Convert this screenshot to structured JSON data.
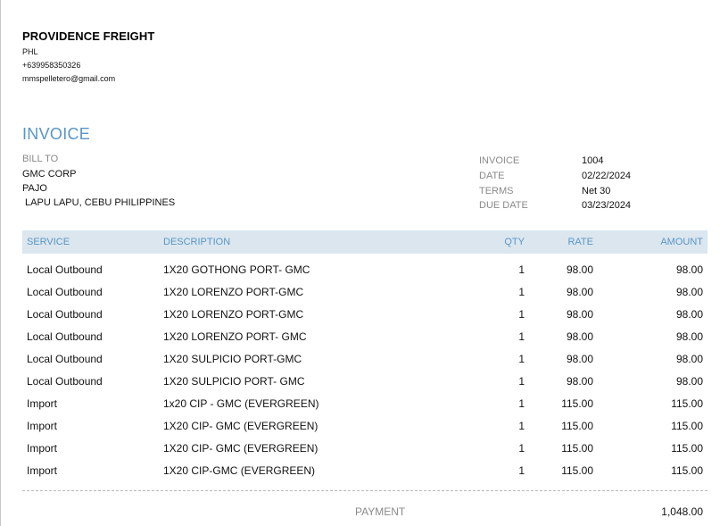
{
  "company": {
    "name": "PROVIDENCE FREIGHT",
    "country": "PHL",
    "phone": "+639958350326",
    "email": "mmspelletero@gmail.com"
  },
  "title": "INVOICE",
  "bill_to": {
    "label": "BILL TO",
    "line1": "GMC CORP",
    "line2": "PAJO",
    "line3": " LAPU LAPU, CEBU PHILIPPINES"
  },
  "meta": {
    "invoice_label": "INVOICE",
    "invoice_value": "1004",
    "date_label": "DATE",
    "date_value": "02/22/2024",
    "terms_label": "TERMS",
    "terms_value": "Net 30",
    "due_label": "DUE DATE",
    "due_value": "03/23/2024"
  },
  "table": {
    "headers": {
      "service": "SERVICE",
      "description": "DESCRIPTION",
      "qty": "QTY",
      "rate": "RATE",
      "amount": "AMOUNT"
    },
    "rows": [
      {
        "service": "Local Outbound",
        "description": "1X20 GOTHONG PORT- GMC",
        "qty": "1",
        "rate": "98.00",
        "amount": "98.00"
      },
      {
        "service": "Local Outbound",
        "description": "1X20 LORENZO PORT-GMC",
        "qty": "1",
        "rate": "98.00",
        "amount": "98.00"
      },
      {
        "service": "Local Outbound",
        "description": "1X20 LORENZO PORT-GMC",
        "qty": "1",
        "rate": "98.00",
        "amount": "98.00"
      },
      {
        "service": "Local Outbound",
        "description": "1X20 LORENZO PORT- GMC",
        "qty": "1",
        "rate": "98.00",
        "amount": "98.00"
      },
      {
        "service": "Local Outbound",
        "description": "1X20 SULPICIO PORT-GMC",
        "qty": "1",
        "rate": "98.00",
        "amount": "98.00"
      },
      {
        "service": "Local Outbound",
        "description": "1X20 SULPICIO PORT- GMC",
        "qty": "1",
        "rate": "98.00",
        "amount": "98.00"
      },
      {
        "service": "Import",
        "description": "1x20 CIP - GMC (EVERGREEN)",
        "qty": "1",
        "rate": "115.00",
        "amount": "115.00"
      },
      {
        "service": "Import",
        "description": "1X20 CIP- GMC (EVERGREEN)",
        "qty": "1",
        "rate": "115.00",
        "amount": "115.00"
      },
      {
        "service": "Import",
        "description": "1X20 CIP- GMC (EVERGREEN)",
        "qty": "1",
        "rate": "115.00",
        "amount": "115.00"
      },
      {
        "service": "Import",
        "description": "1X20 CIP-GMC (EVERGREEN)",
        "qty": "1",
        "rate": "115.00",
        "amount": "115.00"
      }
    ]
  },
  "payment": {
    "label": "PAYMENT",
    "value": "1,048.00"
  },
  "colors": {
    "accent": "#5a96c4",
    "header_bg": "#dbe6ef",
    "label_gray": "#8a8a8a"
  }
}
